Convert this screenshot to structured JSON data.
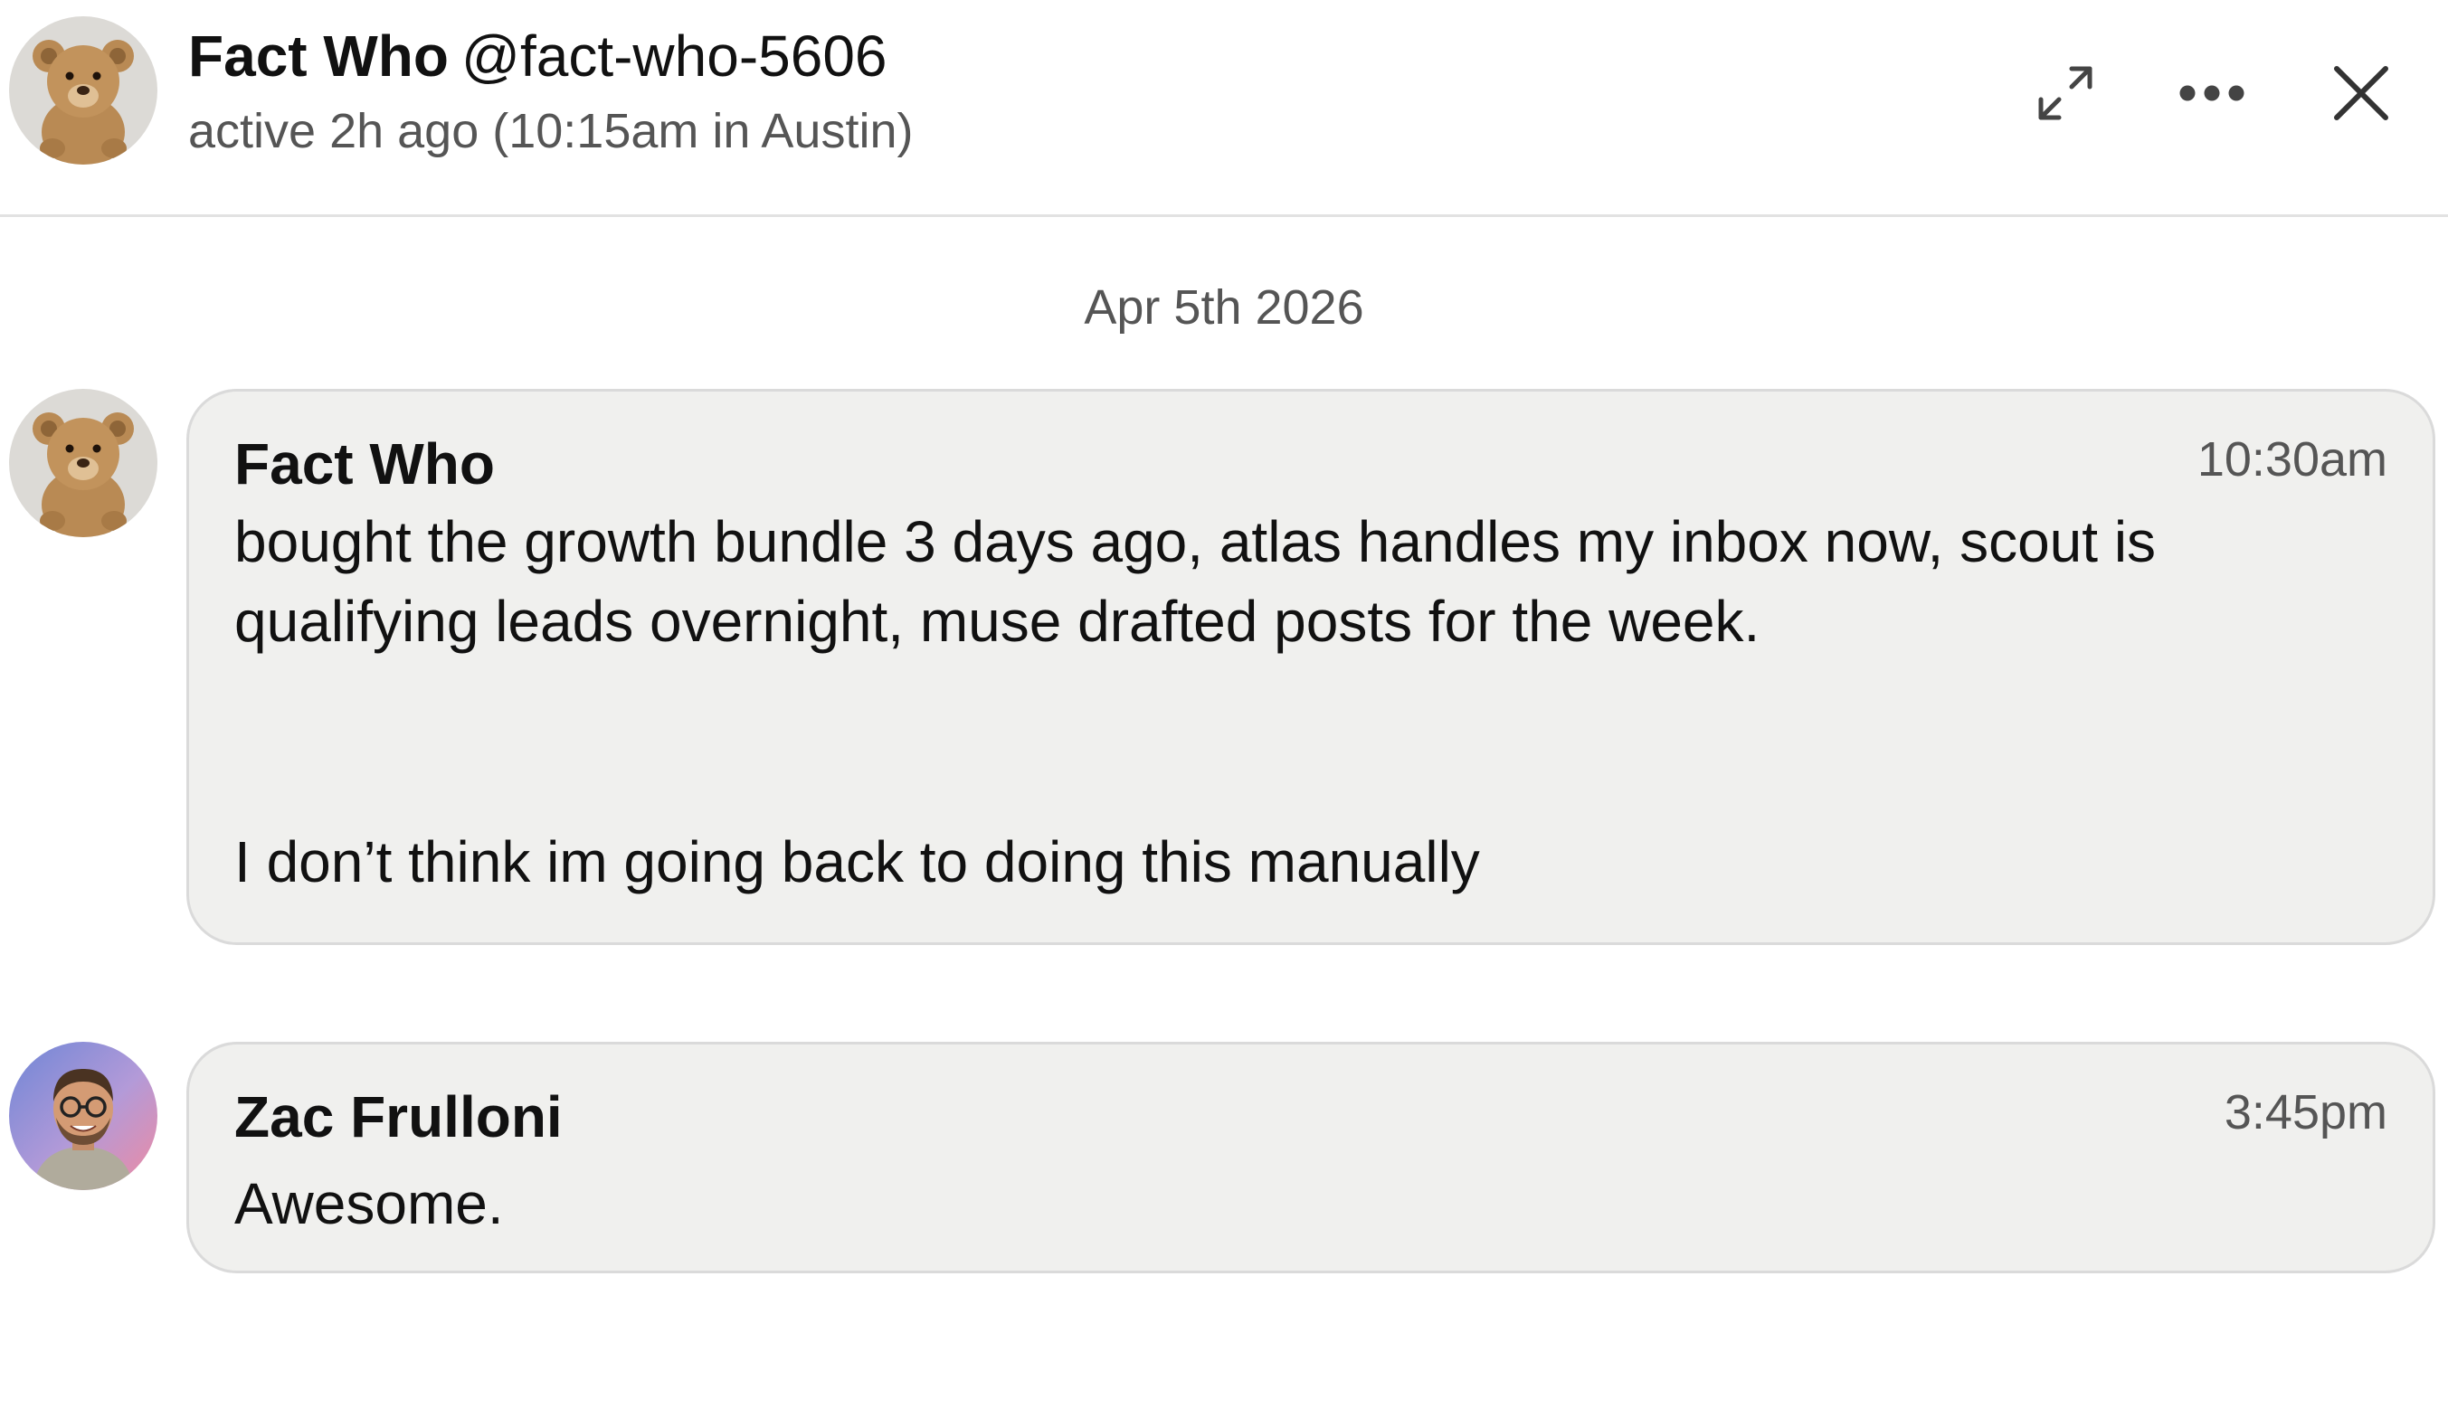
{
  "header": {
    "display_name": "Fact Who",
    "handle": "@fact-who-5606",
    "status": "active 2h ago (10:15am in Austin)",
    "avatar_icon": "teddy-bear-avatar",
    "buttons": {
      "expand_icon": "expand-arrows-icon",
      "more_icon": "more-dots-icon",
      "close_icon": "close-x-icon"
    }
  },
  "conversation": {
    "date_divider": "Apr 5th 2026",
    "messages": [
      {
        "sender": "Fact Who",
        "time": "10:30am",
        "avatar_icon": "teddy-bear-avatar",
        "lines": [
          "bought the growth bundle 3 days ago, atlas handles my inbox now, scout is",
          "qualifying leads overnight, muse drafted posts for the week.",
          "I don’t think im going back to doing this manually"
        ]
      },
      {
        "sender": "Zac Frulloni",
        "time": "3:45pm",
        "avatar_icon": "user-photo-avatar",
        "lines": [
          "Awesome."
        ]
      }
    ]
  },
  "colors": {
    "bubble_background": "#f0f0ee",
    "bubble_border": "#dadada",
    "secondary_text": "#555555",
    "primary_text": "#111111"
  }
}
